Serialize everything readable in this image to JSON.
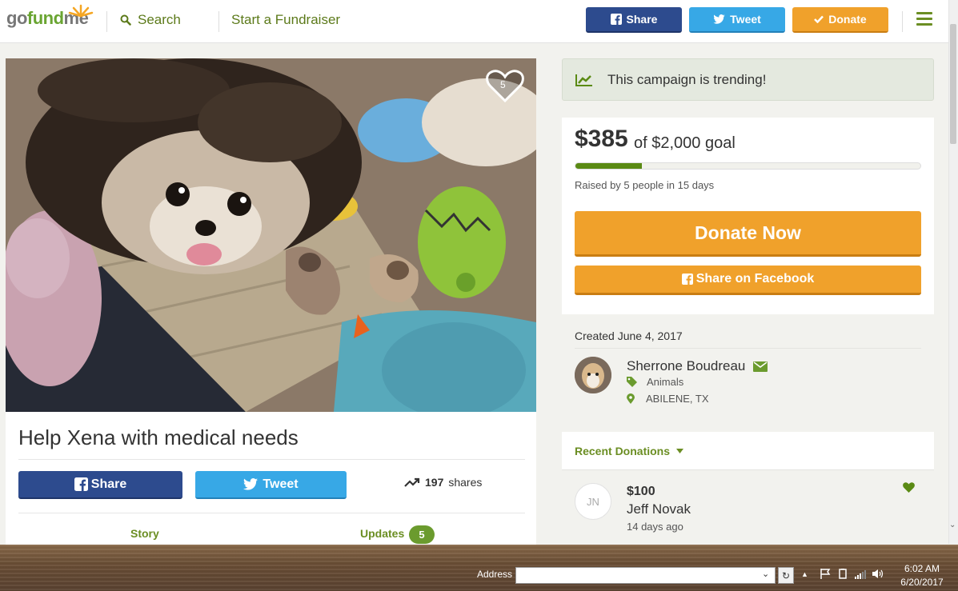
{
  "header": {
    "logo": {
      "part1": "go",
      "part2": "fund",
      "part3": "me"
    },
    "search_label": "Search",
    "start_label": "Start a Fundraiser",
    "share_label": "Share",
    "tweet_label": "Tweet",
    "donate_label": "Donate"
  },
  "campaign": {
    "heart_count": "5",
    "title": "Help Xena with medical needs",
    "share_label": "Share",
    "tweet_label": "Tweet",
    "shares_count": "197",
    "shares_label": "shares",
    "tabs": {
      "story": "Story",
      "updates": "Updates",
      "updates_count": "5"
    }
  },
  "sidebar": {
    "trending_text": "This campaign is trending!",
    "raised": "$385",
    "goal_text": "of $2,000 goal",
    "progress_fraction": 0.1925,
    "raised_by": "Raised by 5 people in 15 days",
    "donate_now": "Donate Now",
    "share_facebook": "Share on Facebook",
    "created": "Created June 4, 2017",
    "organizer": "Sherrone Boudreau",
    "category": "Animals",
    "location": "ABILENE, TX",
    "recent_donations": "Recent Donations",
    "donation": {
      "initials": "JN",
      "amount": "$100",
      "name": "Jeff Novak",
      "time": "14 days ago"
    }
  },
  "taskbar": {
    "address_label": "Address",
    "address_value": "",
    "time": "6:02 AM",
    "date": "6/20/2017"
  },
  "colors": {
    "brand_green": "#6b8e23",
    "facebook": "#2d4b8e",
    "twitter": "#37a8e6",
    "donate_orange": "#f0a12b"
  }
}
